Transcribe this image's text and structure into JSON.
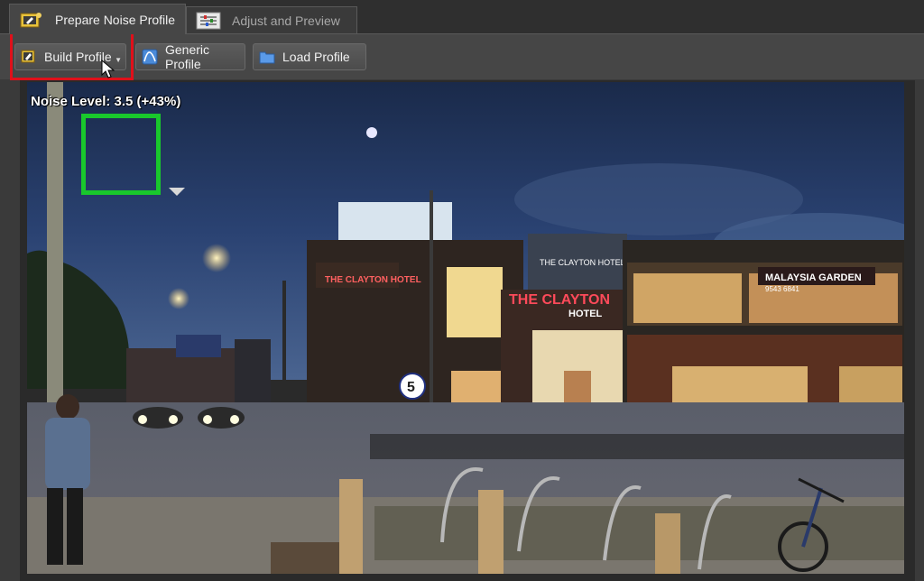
{
  "tabs": [
    {
      "label": "Prepare Noise Profile",
      "active": true
    },
    {
      "label": "Adjust and Preview",
      "active": false
    }
  ],
  "toolbar": {
    "build_label": "Build Profile",
    "generic_label": "Generic Profile",
    "load_label": "Load Profile"
  },
  "viewer": {
    "noise_level": "Noise Level: 3.5 (+43%)"
  },
  "photo_signs": {
    "hotel_left": "THE CLAYTON HOTEL",
    "hotel_center": "THE CLAYTON",
    "hotel_sub": "HOTEL",
    "tower_text": "THE CLAYTON HOTEL",
    "restaurant": "MALAYSIA GARDEN",
    "restaurant_phone": "9543 6841",
    "road_sign": "5"
  },
  "colors": {
    "highlight": "#e0101a",
    "sample_box": "#19c82c"
  }
}
